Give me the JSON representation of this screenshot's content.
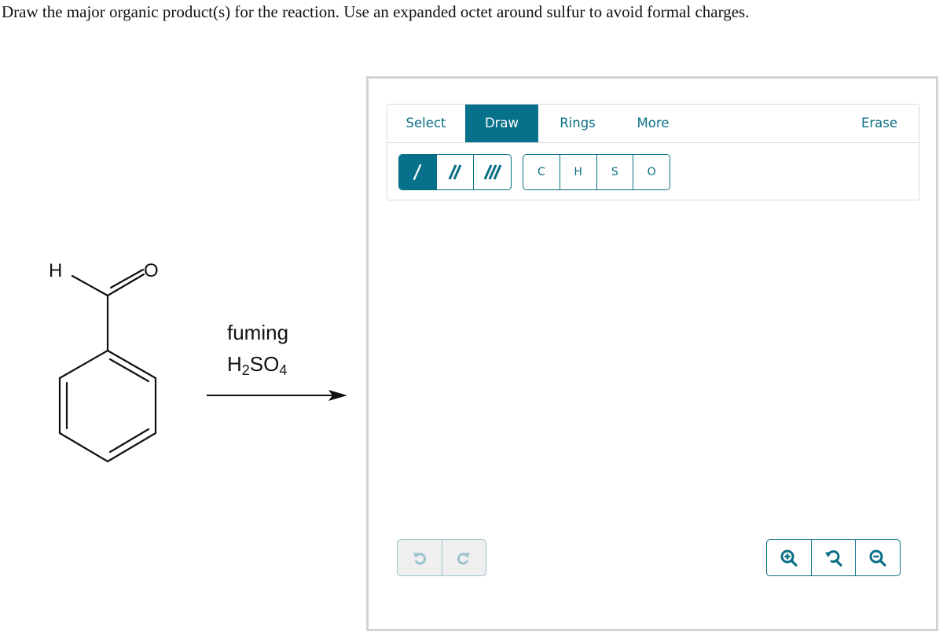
{
  "prompt": "Draw the major organic product(s) for the reaction. Use an expanded octet around sulfur to avoid formal charges.",
  "reaction": {
    "reactant": {
      "name": "benzaldehyde",
      "atom_labels": {
        "hydrogen": "H",
        "oxygen": "O"
      }
    },
    "reagents": {
      "line1": "fuming",
      "line2_parts": {
        "h": "H",
        "h_sub": "2",
        "so": "SO",
        "o_sub": "4"
      }
    },
    "arrow": "reaction-arrow"
  },
  "editor": {
    "tabs": [
      {
        "label": "Select",
        "active": false
      },
      {
        "label": "Draw",
        "active": true
      },
      {
        "label": "Rings",
        "active": false
      },
      {
        "label": "More",
        "active": false
      }
    ],
    "erase_label": "Erase",
    "bond_tools": [
      {
        "name": "single-bond",
        "glyph": "/",
        "active": true
      },
      {
        "name": "double-bond",
        "glyph": "//",
        "active": false
      },
      {
        "name": "triple-bond",
        "glyph": "///",
        "active": false
      }
    ],
    "atom_tools": [
      {
        "label": "C"
      },
      {
        "label": "H"
      },
      {
        "label": "S"
      },
      {
        "label": "O"
      }
    ],
    "history": {
      "undo": {
        "icon": "undo-icon",
        "enabled": false
      },
      "redo": {
        "icon": "redo-icon",
        "enabled": false
      }
    },
    "zoom_controls": [
      {
        "icon": "zoom-in-icon"
      },
      {
        "icon": "reset-zoom-icon"
      },
      {
        "icon": "zoom-out-icon"
      }
    ],
    "colors": {
      "accent": "#07708a",
      "disabled": "#9cc3cd",
      "frame_border": "#d3d3d3"
    }
  }
}
